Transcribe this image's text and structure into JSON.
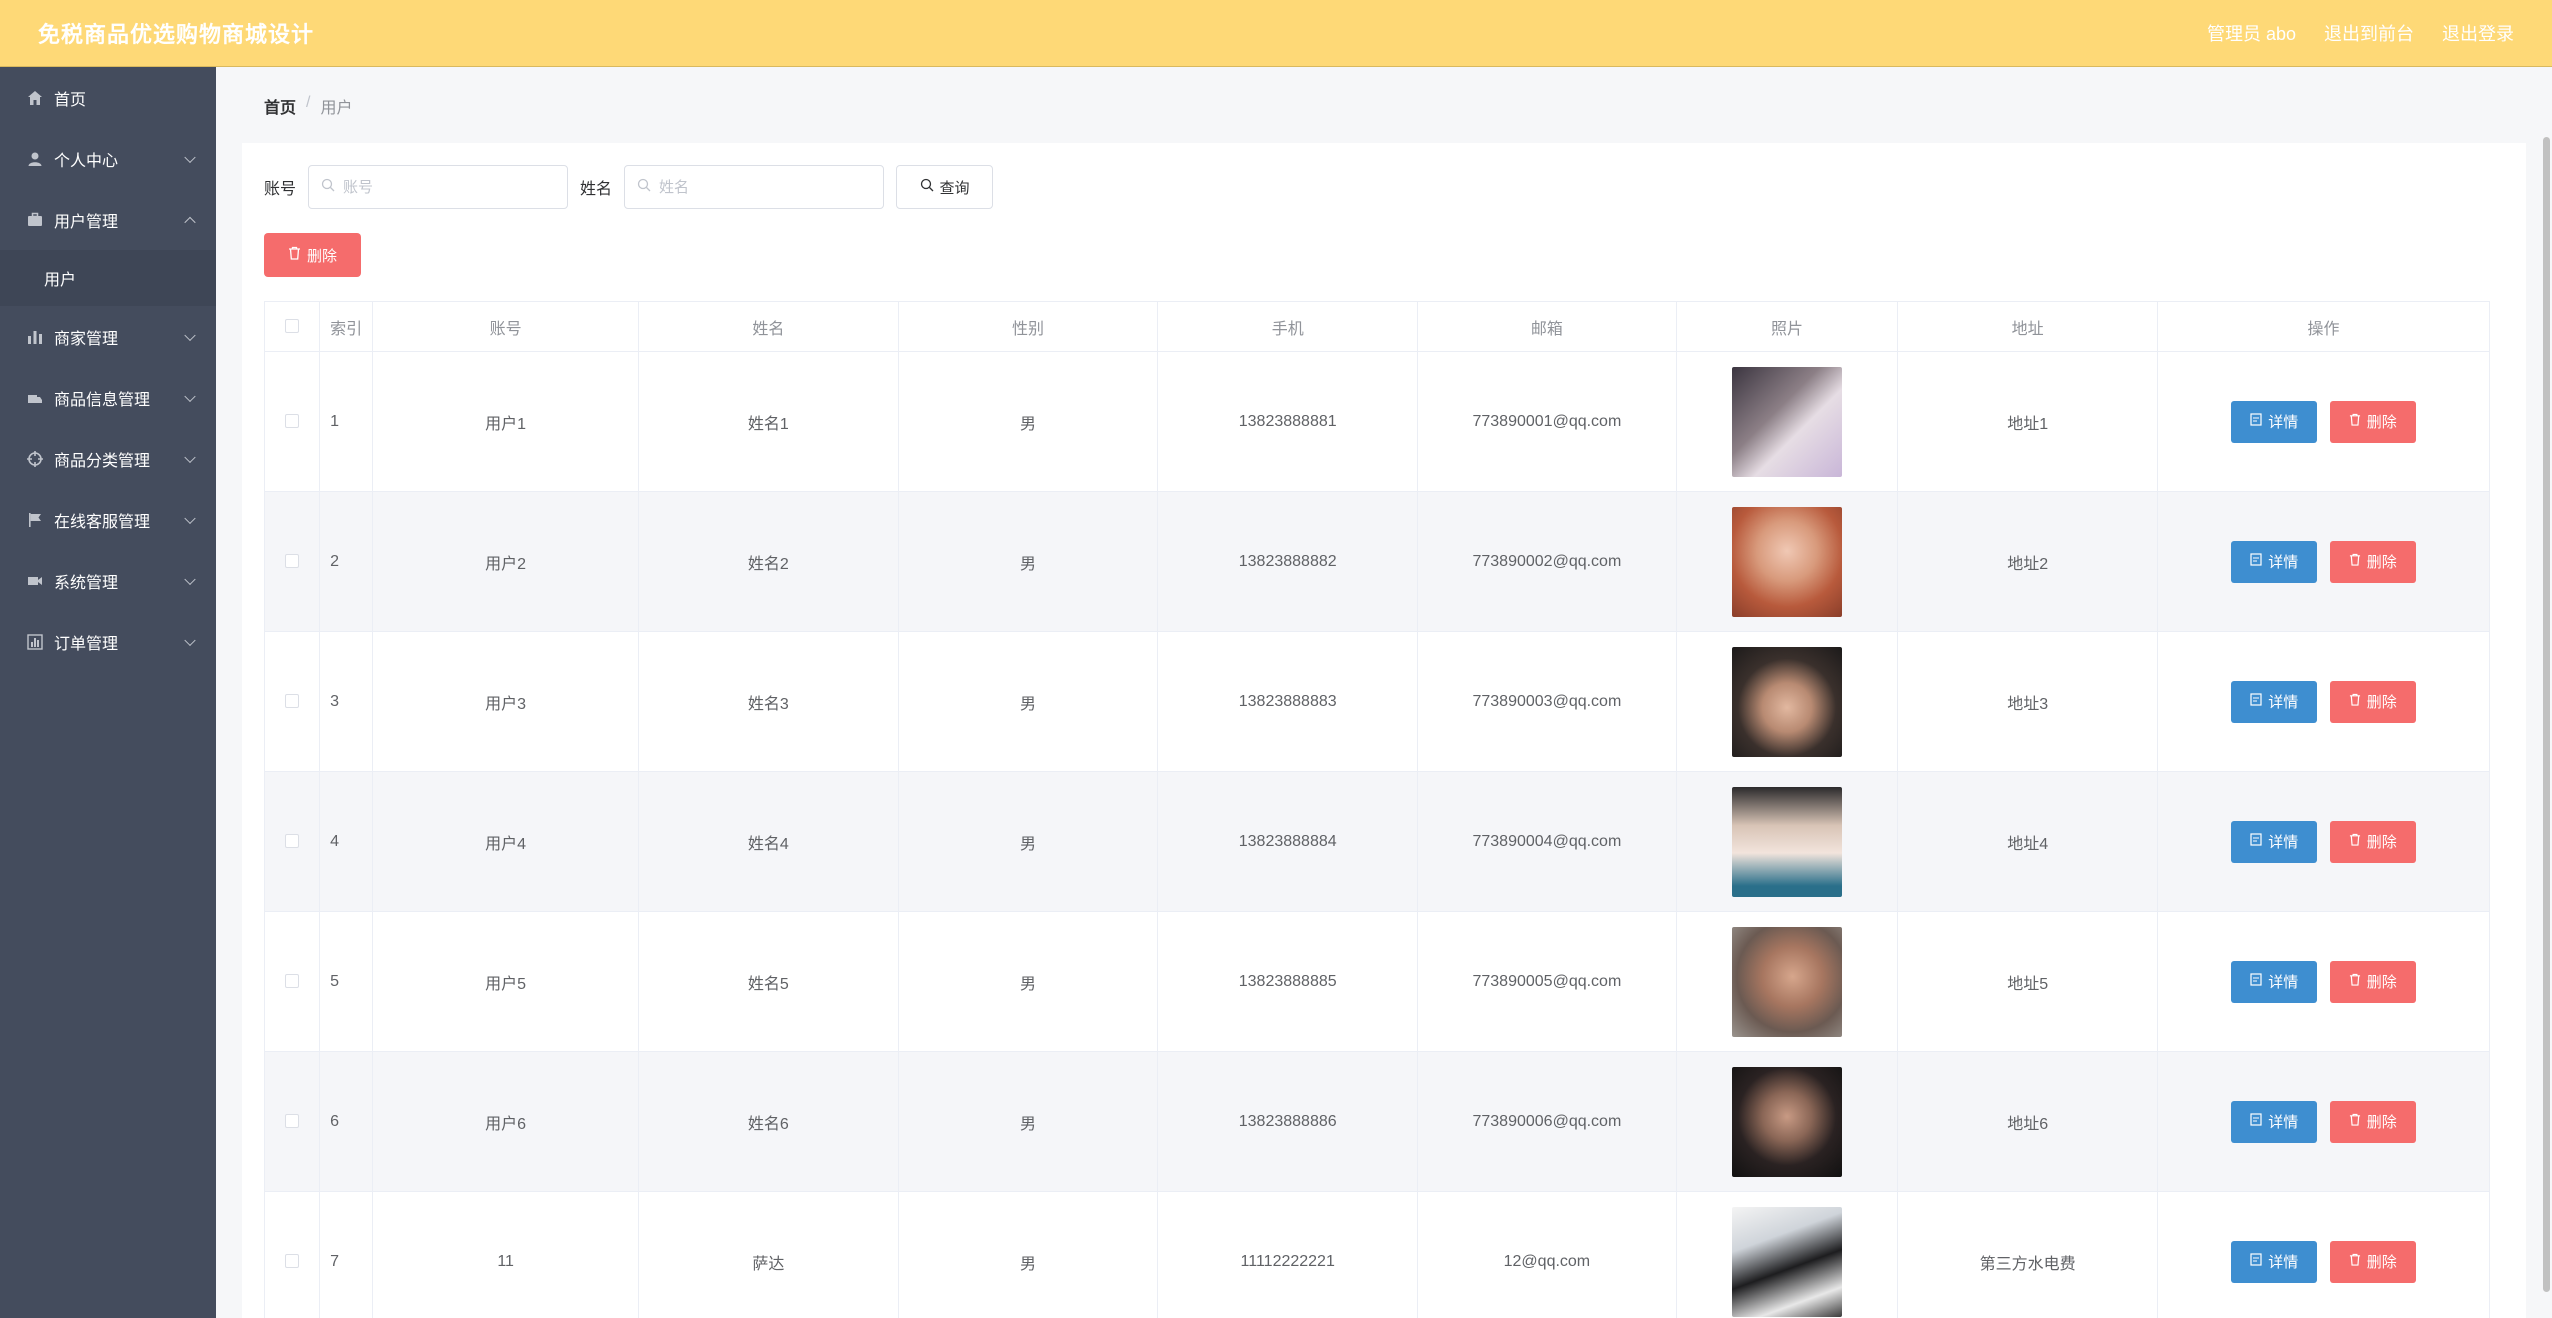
{
  "header": {
    "title": "免税商品优选购物商城设计",
    "admin": "管理员 abo",
    "back_console": "退出到前台",
    "logout": "退出登录"
  },
  "sidebar": {
    "items": [
      {
        "label": "首页",
        "icon": "home-icon"
      },
      {
        "label": "个人中心",
        "icon": "user-icon"
      },
      {
        "label": "用户管理",
        "icon": "briefcase-icon",
        "expanded": true
      },
      {
        "label": "商家管理",
        "icon": "chart-icon"
      },
      {
        "label": "商品信息管理",
        "icon": "truck-icon"
      },
      {
        "label": "商品分类管理",
        "icon": "target-icon"
      },
      {
        "label": "在线客服管理",
        "icon": "flag-icon"
      },
      {
        "label": "系统管理",
        "icon": "video-icon"
      },
      {
        "label": "订单管理",
        "icon": "stats-icon"
      }
    ],
    "submenu_user": "用户"
  },
  "breadcrumb": {
    "home": "首页",
    "separator": "/",
    "current": "用户"
  },
  "search": {
    "account_label": "账号",
    "account_placeholder": "账号",
    "name_label": "姓名",
    "name_placeholder": "姓名",
    "query_label": "查询"
  },
  "batch_delete_label": "删除",
  "table": {
    "headers": [
      "索引",
      "账号",
      "姓名",
      "性别",
      "手机",
      "邮箱",
      "照片",
      "地址",
      "操作"
    ],
    "detail_label": "详情",
    "delete_label": "删除",
    "rows": [
      {
        "index": "1",
        "account": "用户1",
        "name": "姓名1",
        "gender": "男",
        "phone": "13823888881",
        "email": "773890001@qq.com",
        "address": "地址1"
      },
      {
        "index": "2",
        "account": "用户2",
        "name": "姓名2",
        "gender": "男",
        "phone": "13823888882",
        "email": "773890002@qq.com",
        "address": "地址2"
      },
      {
        "index": "3",
        "account": "用户3",
        "name": "姓名3",
        "gender": "男",
        "phone": "13823888883",
        "email": "773890003@qq.com",
        "address": "地址3"
      },
      {
        "index": "4",
        "account": "用户4",
        "name": "姓名4",
        "gender": "男",
        "phone": "13823888884",
        "email": "773890004@qq.com",
        "address": "地址4"
      },
      {
        "index": "5",
        "account": "用户5",
        "name": "姓名5",
        "gender": "男",
        "phone": "13823888885",
        "email": "773890005@qq.com",
        "address": "地址5"
      },
      {
        "index": "6",
        "account": "用户6",
        "name": "姓名6",
        "gender": "男",
        "phone": "13823888886",
        "email": "773890006@qq.com",
        "address": "地址6"
      },
      {
        "index": "7",
        "account": "11",
        "name": "萨达",
        "gender": "男",
        "phone": "11112222221",
        "email": "12@qq.com",
        "address": "第三方水电费"
      }
    ]
  },
  "colors": {
    "header_bg": "#fed977",
    "sidebar_bg": "#444c5d",
    "detail_btn": "#3e8ed0",
    "delete_btn": "#f56c6c"
  }
}
